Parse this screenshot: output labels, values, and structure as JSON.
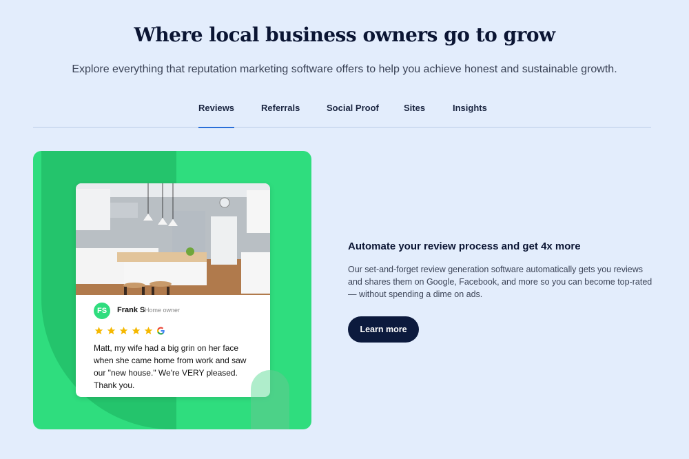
{
  "header": {
    "title": "Where local business owners go to grow",
    "subtitle": "Explore everything that reputation marketing software offers to help you achieve honest and sustainable growth."
  },
  "tabs": [
    {
      "label": "Reviews",
      "active": true
    },
    {
      "label": "Referrals",
      "active": false
    },
    {
      "label": "Social Proof",
      "active": false
    },
    {
      "label": "Sites",
      "active": false
    },
    {
      "label": "Insights",
      "active": false
    }
  ],
  "review_card": {
    "image": "kitchen-photo",
    "initials": "FS",
    "name": "Frank S",
    "role": "Home owner",
    "rating": 5,
    "source_icon": "google-icon",
    "text": "Matt, my wife had a big grin on her face when she came home from work and saw our \"new house.\" We're VERY pleased. Thank you."
  },
  "feature": {
    "title": "Automate your review process and get 4x more",
    "body": "Our set-and-forget review generation software automatically gets you reviews and shares them on Google, Facebook, and more so you can become top-rated — without spending a dime on ads.",
    "cta_label": "Learn more"
  },
  "colors": {
    "background": "#e3edfc",
    "accent_green": "#2fdd7e",
    "tab_underline": "#2a6fd8",
    "button_dark": "#0c1a3d",
    "star": "#f5b800"
  }
}
